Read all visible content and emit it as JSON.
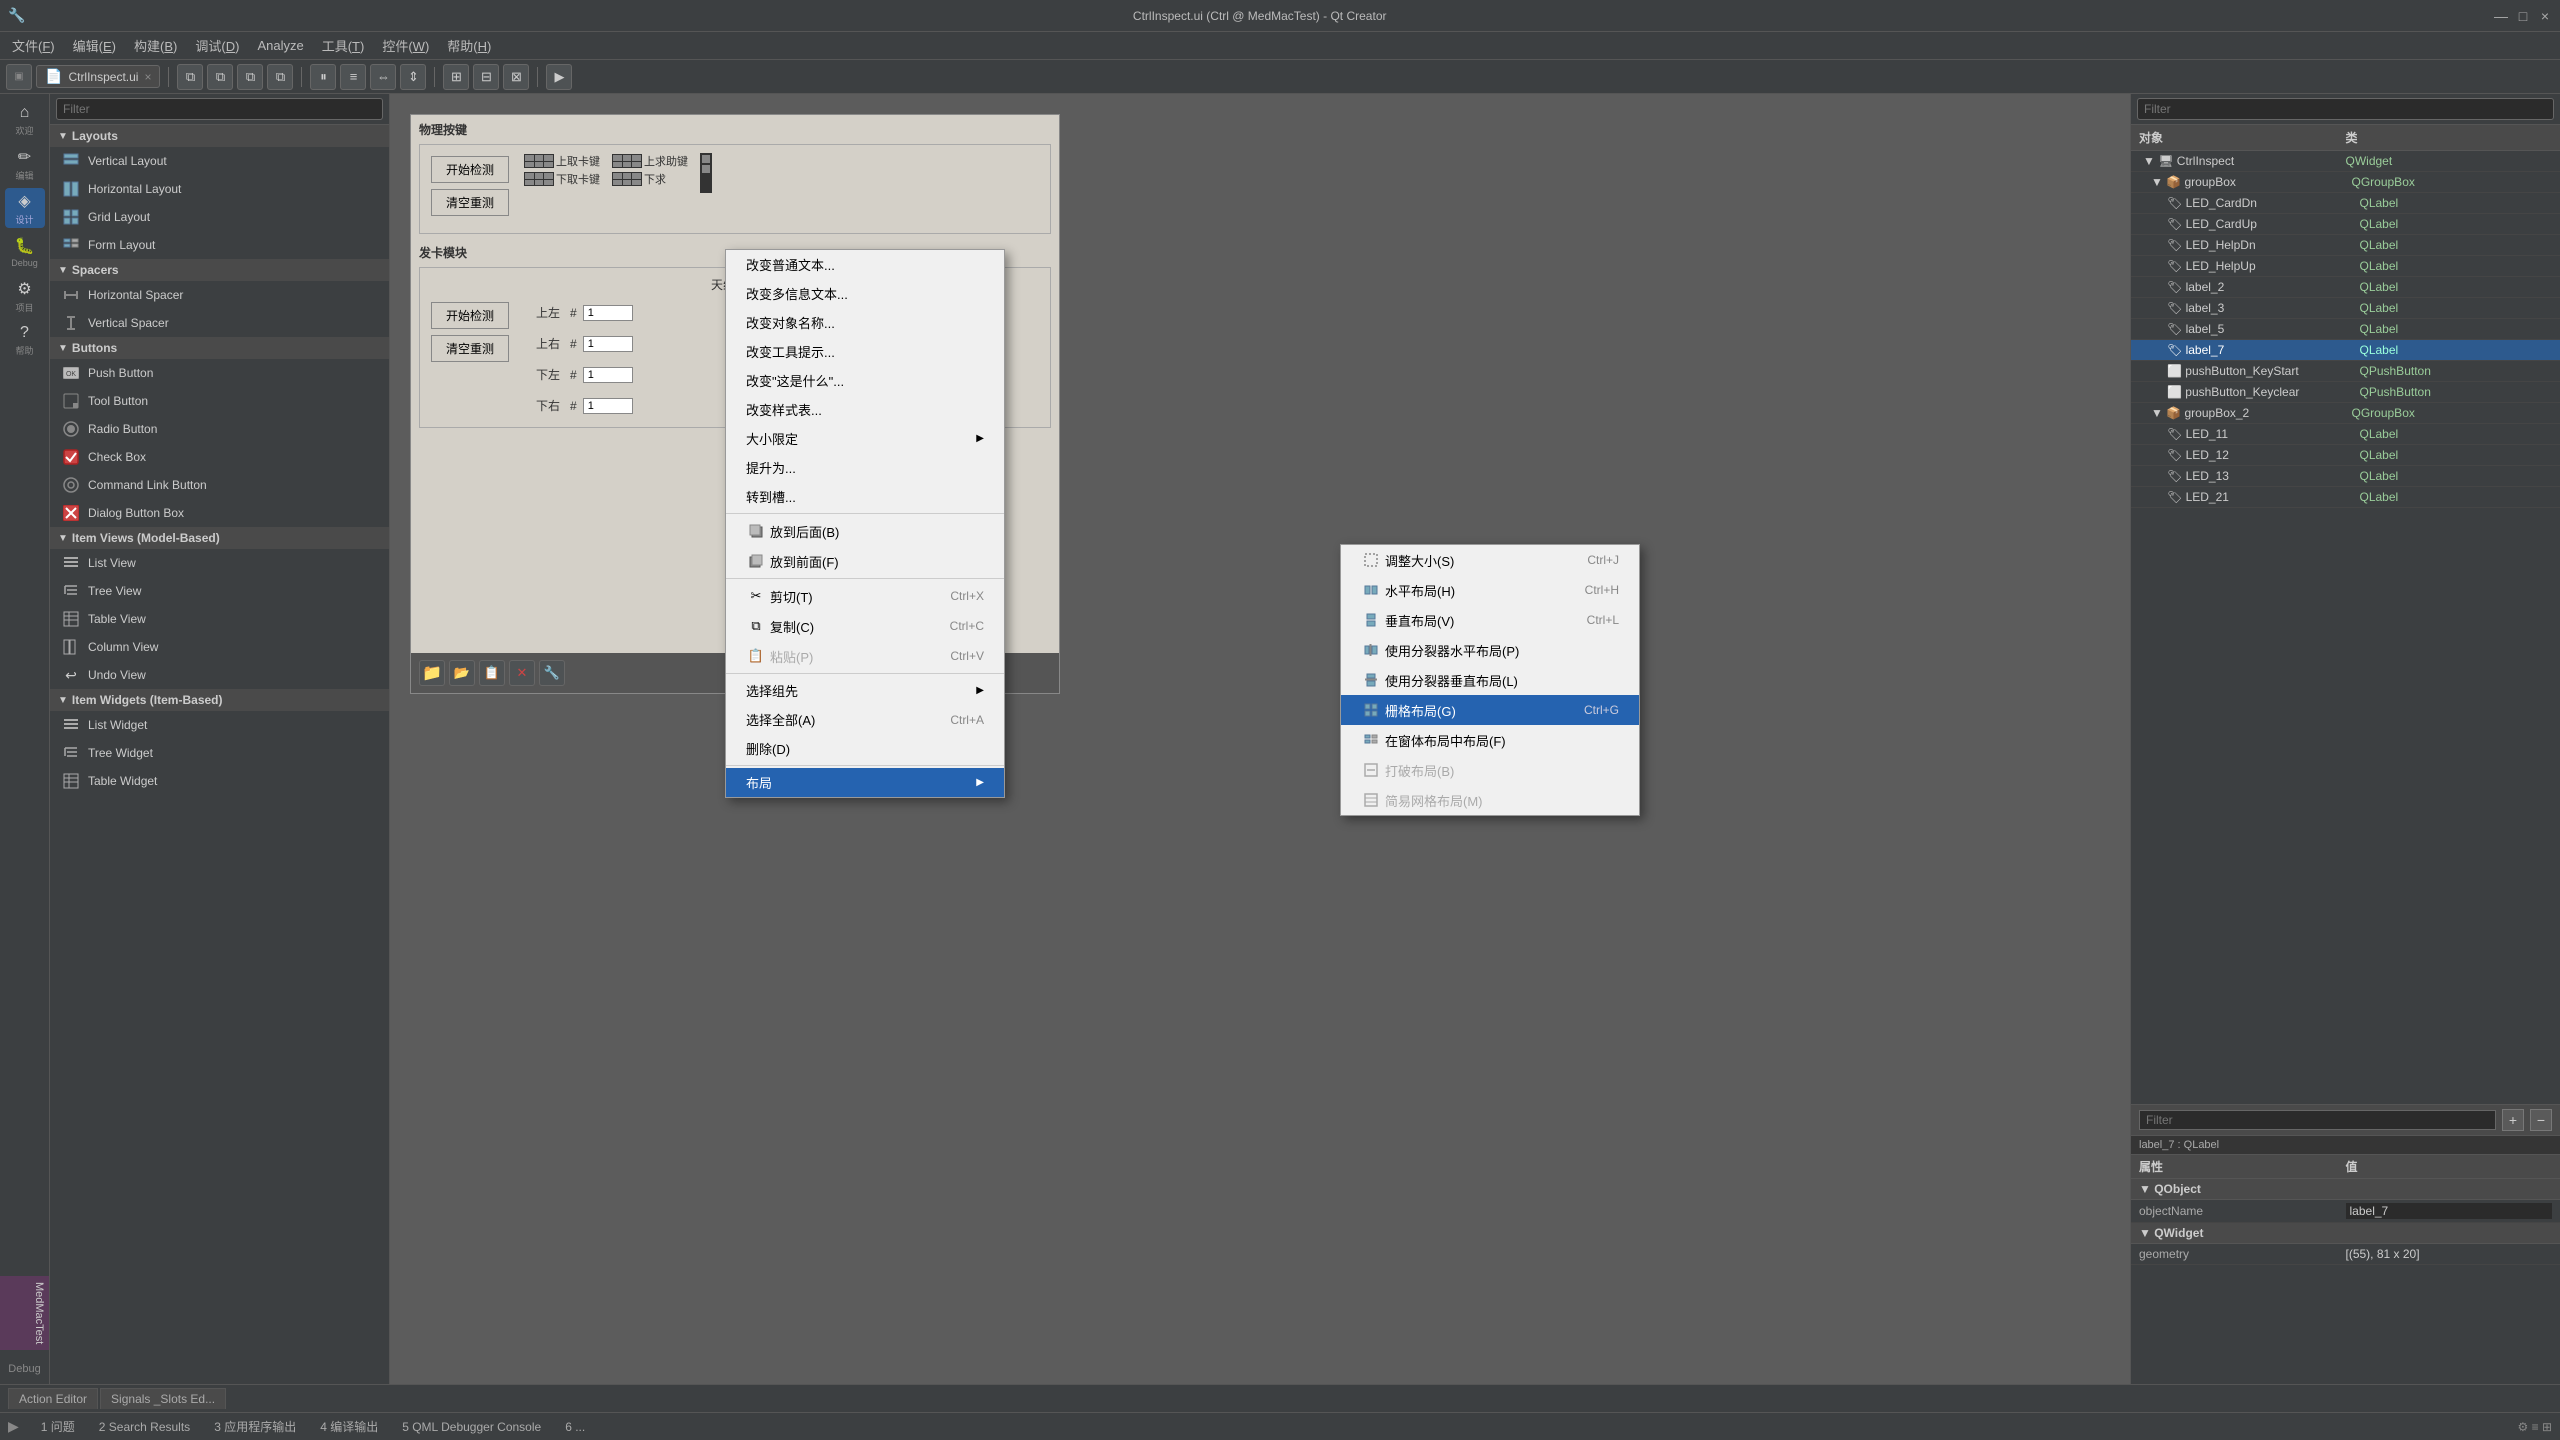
{
  "titlebar": {
    "title": "CtrlInspect.ui (Ctrl @ MedMacTest) - Qt Creator",
    "minimize": "—",
    "maximize": "□",
    "close": "×"
  },
  "menubar": {
    "items": [
      {
        "label": "文件(F)",
        "key": "F"
      },
      {
        "label": "编辑(E)",
        "key": "E"
      },
      {
        "label": "构建(B)",
        "key": "B"
      },
      {
        "label": "调试(D)",
        "key": "D"
      },
      {
        "label": "Analyze"
      },
      {
        "label": "工具(T)",
        "key": "T"
      },
      {
        "label": "控件(W)",
        "key": "W"
      },
      {
        "label": "帮助(H)",
        "key": "H"
      }
    ]
  },
  "toolbar": {
    "file_label": "CtrlInspect.ui",
    "close_btn": "×"
  },
  "widget_panel": {
    "filter_placeholder": "Filter",
    "sections": [
      {
        "name": "Layouts",
        "items": [
          {
            "label": "Vertical Layout",
            "icon": "▤"
          },
          {
            "label": "Horizontal Layout",
            "icon": "▥"
          },
          {
            "label": "Grid Layout",
            "icon": "⊞"
          },
          {
            "label": "Form Layout",
            "icon": "⊟"
          }
        ]
      },
      {
        "name": "Spacers",
        "items": [
          {
            "label": "Horizontal Spacer",
            "icon": "↔"
          },
          {
            "label": "Vertical Spacer",
            "icon": "↕"
          }
        ]
      },
      {
        "name": "Buttons",
        "items": [
          {
            "label": "Push Button",
            "icon": "□"
          },
          {
            "label": "Tool Button",
            "icon": "⊡"
          },
          {
            "label": "Radio Button",
            "icon": "◉"
          },
          {
            "label": "Check Box",
            "icon": "☑"
          },
          {
            "label": "Command Link Button",
            "icon": "⊙"
          },
          {
            "label": "Dialog Button Box",
            "icon": "⊠"
          }
        ]
      },
      {
        "name": "Item Views (Model-Based)",
        "items": [
          {
            "label": "List View",
            "icon": "≡"
          },
          {
            "label": "Tree View",
            "icon": "⋮"
          },
          {
            "label": "Table View",
            "icon": "⊞"
          },
          {
            "label": "Column View",
            "icon": "⊟"
          },
          {
            "label": "Undo View",
            "icon": "↩"
          }
        ]
      },
      {
        "name": "Item Widgets (Item-Based)",
        "items": [
          {
            "label": "List Widget",
            "icon": "≡"
          },
          {
            "label": "Tree Widget",
            "icon": "⋮"
          },
          {
            "label": "Table Widget",
            "icon": "⊞"
          }
        ]
      }
    ]
  },
  "canvas": {
    "section1_label": "物理按键",
    "section2_label": "发卡模块",
    "btn_start": "开始检测",
    "btn_clear": "清空重测",
    "tab1": "上取卡键",
    "tab2": "下取卡键",
    "tab3": "上求助键",
    "tab4": "下求",
    "antenna_label": "天线检测",
    "positions": [
      "上左",
      "上右",
      "下左",
      "下右"
    ],
    "hash": "#",
    "input_val": "1"
  },
  "context_menu": {
    "items": [
      {
        "label": "改变普通文本...",
        "shortcut": "",
        "has_arrow": false
      },
      {
        "label": "改变多信息文本...",
        "shortcut": "",
        "has_arrow": false
      },
      {
        "label": "改变对象名称...",
        "shortcut": "",
        "has_arrow": false
      },
      {
        "label": "改变工具提示...",
        "shortcut": "",
        "has_arrow": false
      },
      {
        "label": "改变\"这是什么\"...",
        "shortcut": "",
        "has_arrow": false
      },
      {
        "label": "改变样式表...",
        "shortcut": "",
        "has_arrow": false
      },
      {
        "label": "大小限定",
        "shortcut": "",
        "has_arrow": true
      },
      {
        "label": "提升为...",
        "shortcut": "",
        "has_arrow": false
      },
      {
        "label": "转到槽...",
        "shortcut": "",
        "has_arrow": false
      },
      {
        "label": "sep1"
      },
      {
        "label": "放到后面(B)",
        "shortcut": "",
        "has_arrow": false,
        "icon": "back"
      },
      {
        "label": "放到前面(F)",
        "shortcut": "",
        "has_arrow": false,
        "icon": "front"
      },
      {
        "label": "sep2"
      },
      {
        "label": "剪切(T)",
        "shortcut": "Ctrl+X",
        "has_arrow": false,
        "icon": "cut"
      },
      {
        "label": "复制(C)",
        "shortcut": "Ctrl+C",
        "has_arrow": false,
        "icon": "copy"
      },
      {
        "label": "粘贴(P)",
        "shortcut": "Ctrl+V",
        "has_arrow": false,
        "icon": "paste",
        "disabled": true
      },
      {
        "label": "sep3"
      },
      {
        "label": "选择组先",
        "shortcut": "",
        "has_arrow": true
      },
      {
        "label": "选择全部(A)",
        "shortcut": "Ctrl+A",
        "has_arrow": false
      },
      {
        "label": "删除(D)",
        "shortcut": "",
        "has_arrow": false
      },
      {
        "label": "sep4"
      },
      {
        "label": "布局",
        "shortcut": "",
        "has_arrow": true,
        "highlighted": true
      }
    ]
  },
  "layout_submenu": {
    "items": [
      {
        "label": "调整大小(S)",
        "shortcut": "Ctrl+J",
        "icon": "resize"
      },
      {
        "label": "水平布局(H)",
        "shortcut": "Ctrl+H",
        "icon": "hlayout"
      },
      {
        "label": "垂直布局(V)",
        "shortcut": "Ctrl+L",
        "icon": "vlayout"
      },
      {
        "label": "使用分裂器水平布局(P)",
        "shortcut": "",
        "icon": "hsplitter"
      },
      {
        "label": "使用分裂器垂直布局(L)",
        "shortcut": "",
        "icon": "vsplitter"
      },
      {
        "label": "栅格布局(G)",
        "shortcut": "Ctrl+G",
        "icon": "grid",
        "highlighted": true
      },
      {
        "label": "在窗体布局中布局(F)",
        "shortcut": "",
        "icon": "formlayout"
      },
      {
        "label": "打破布局(B)",
        "shortcut": "",
        "icon": "breaklayout",
        "disabled": true
      },
      {
        "label": "简易网格布局(M)",
        "shortcut": "",
        "icon": "simplegrid",
        "disabled": true
      }
    ]
  },
  "right_panel": {
    "filter_placeholder": "Filter",
    "col_object": "对象",
    "col_class": "类",
    "tree": [
      {
        "name": "CtrlInspect",
        "type": "QWidget",
        "level": 0,
        "expanded": true
      },
      {
        "name": "groupBox",
        "type": "QGroupBox",
        "level": 1,
        "expanded": true
      },
      {
        "name": "LED_CardDn",
        "type": "QLabel",
        "level": 2
      },
      {
        "name": "LED_CardUp",
        "type": "QLabel",
        "level": 2
      },
      {
        "name": "LED_HelpDn",
        "type": "QLabel",
        "level": 2
      },
      {
        "name": "LED_HelpUp",
        "type": "QLabel",
        "level": 2
      },
      {
        "name": "label_2",
        "type": "QLabel",
        "level": 2
      },
      {
        "name": "label_3",
        "type": "QLabel",
        "level": 2
      },
      {
        "name": "label_5",
        "type": "QLabel",
        "level": 2
      },
      {
        "name": "label_7",
        "type": "QLabel",
        "level": 2
      },
      {
        "name": "pushButton_KeyStart",
        "type": "QPushButton",
        "level": 2
      },
      {
        "name": "pushButton_Keyclear",
        "type": "QPushButton",
        "level": 2
      },
      {
        "name": "groupBox_2",
        "type": "QGroupBox",
        "level": 1,
        "expanded": true
      },
      {
        "name": "LED_11",
        "type": "QLabel",
        "level": 2
      },
      {
        "name": "LED_12",
        "type": "QLabel",
        "level": 2
      },
      {
        "name": "LED_13",
        "type": "QLabel",
        "level": 2
      },
      {
        "name": "LED_21",
        "type": "QLabel",
        "level": 2
      }
    ]
  },
  "props_panel": {
    "filter_placeholder": "Filter",
    "obj_label": "label_7 : QLabel",
    "col_property": "属性",
    "col_value": "值",
    "sections": [
      {
        "name": "QObject",
        "props": [
          {
            "name": "objectName",
            "value": "label_7"
          }
        ]
      },
      {
        "name": "QWidget",
        "props": [
          {
            "name": "geometry",
            "value": "[(55), 81 x 20]"
          }
        ]
      }
    ]
  },
  "editor_tabs": {
    "tabs": [
      {
        "label": "Action Editor"
      },
      {
        "label": "Signals _Slots Ed..."
      }
    ]
  },
  "statusbar": {
    "tabs": [
      {
        "label": "1 问题"
      },
      {
        "label": "2 Search Results"
      },
      {
        "label": "3 应用程序输出"
      },
      {
        "label": "4 编译输出"
      },
      {
        "label": "5 QML Debugger Console"
      },
      {
        "label": "6 ..."
      }
    ]
  },
  "left_icons": [
    {
      "label": "欢迎",
      "icon": "⌂"
    },
    {
      "label": "编辑",
      "icon": "✏"
    },
    {
      "label": "设计",
      "icon": "◈"
    },
    {
      "label": "Debug",
      "icon": "🐛"
    },
    {
      "label": "项目",
      "icon": "⚙"
    },
    {
      "label": "帮助",
      "icon": "?"
    }
  ],
  "mac_test": {
    "label": "MedMacTest",
    "debug_label": "Debug"
  }
}
